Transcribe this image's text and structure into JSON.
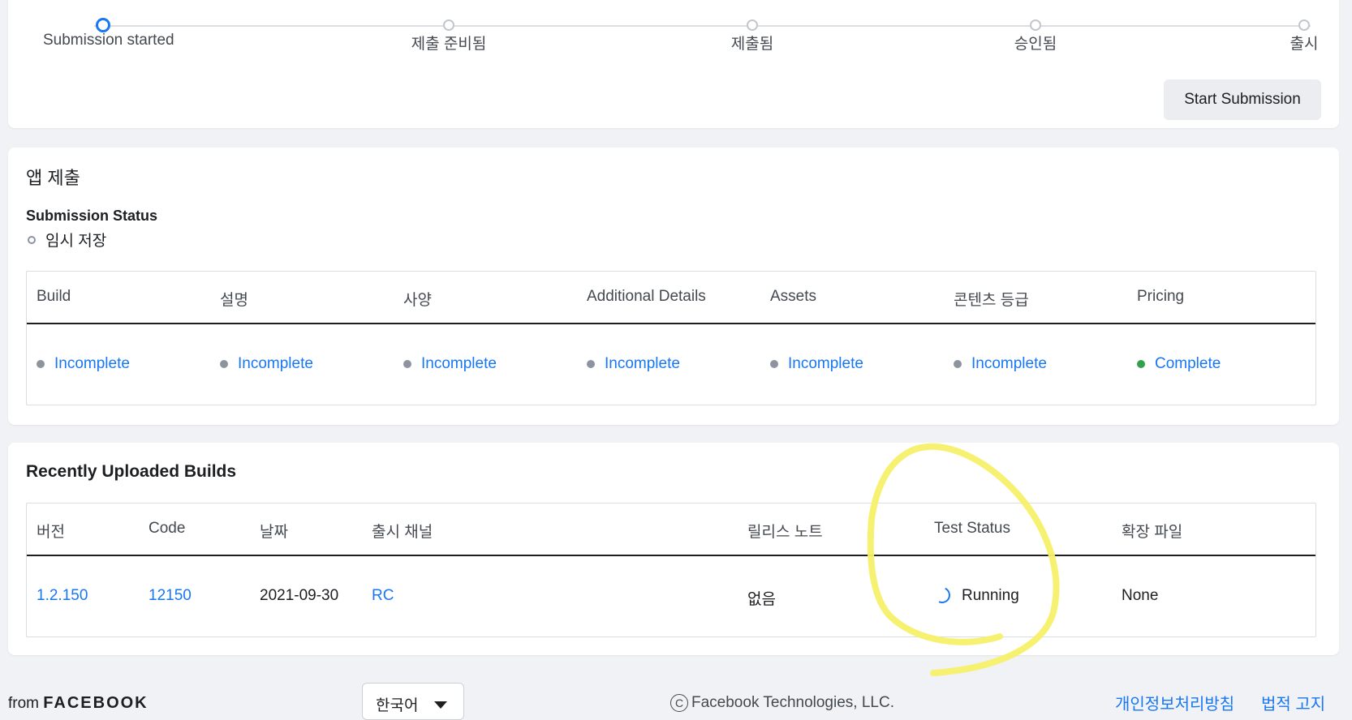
{
  "progress": {
    "steps": [
      {
        "label": "Submission started",
        "state": "active"
      },
      {
        "label": "제출 준비됨",
        "state": "pending"
      },
      {
        "label": "제출됨",
        "state": "pending"
      },
      {
        "label": "승인됨",
        "state": "pending"
      },
      {
        "label": "출시",
        "state": "pending"
      }
    ],
    "start_button": "Start Submission"
  },
  "submission": {
    "title": "앱 제출",
    "status_heading": "Submission Status",
    "status_value": "임시 저장",
    "columns": [
      "Build",
      "설명",
      "사양",
      "Additional Details",
      "Assets",
      "콘텐츠 등급",
      "Pricing"
    ],
    "statuses": [
      {
        "label": "Incomplete",
        "state": "incomplete"
      },
      {
        "label": "Incomplete",
        "state": "incomplete"
      },
      {
        "label": "Incomplete",
        "state": "incomplete"
      },
      {
        "label": "Incomplete",
        "state": "incomplete"
      },
      {
        "label": "Incomplete",
        "state": "incomplete"
      },
      {
        "label": "Incomplete",
        "state": "incomplete"
      },
      {
        "label": "Complete",
        "state": "complete"
      }
    ]
  },
  "builds": {
    "title": "Recently Uploaded Builds",
    "columns": [
      "버전",
      "Code",
      "날짜",
      "출시 채널",
      "릴리스 노트",
      "Test Status",
      "확장 파일"
    ],
    "rows": [
      {
        "version": "1.2.150",
        "code": "12150",
        "date": "2021-09-30",
        "channel": "RC",
        "notes": "없음",
        "test_status": "Running",
        "expansion": "None"
      }
    ]
  },
  "footer": {
    "from": "from",
    "brand": "FACEBOOK",
    "language": "한국어",
    "copyright": "Facebook Technologies, LLC.",
    "privacy": "개인정보처리방침",
    "legal": "법적 고지"
  },
  "colors": {
    "accent": "#1877f2",
    "complete": "#31a24c",
    "incomplete": "#8d949e",
    "annotation": "#f7f06a"
  }
}
